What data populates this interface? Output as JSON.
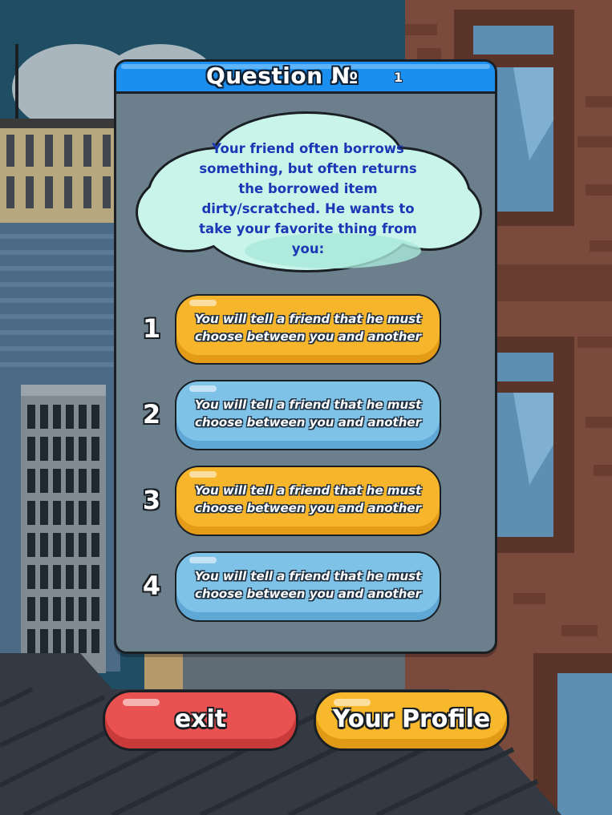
{
  "header": {
    "title": "Question №",
    "number": "1"
  },
  "question": {
    "text": "Your friend often borrows something, but often returns the borrowed item dirty/scratched. He wants to take your favorite thing from you:"
  },
  "answers": [
    {
      "index": "1",
      "text": "You will tell a friend that he must choose between you and another",
      "color": "#f7b52b"
    },
    {
      "index": "2",
      "text": "You will tell a friend that he must choose between you and another",
      "color": "#7fc2e7"
    },
    {
      "index": "3",
      "text": "You will tell a friend that he must choose between you and another",
      "color": "#f7b52b"
    },
    {
      "index": "4",
      "text": "You will tell a friend that he must choose between you and another",
      "color": "#7fc2e7"
    }
  ],
  "buttons": {
    "exit_label": "exit",
    "profile_label": "Your Profile"
  },
  "colors": {
    "header_blue": "#1b8ff0",
    "panel": "#6c7f8d",
    "exit_red": "#ea5252",
    "profile_orange": "#f8b82c",
    "question_text": "#1b37b5"
  }
}
